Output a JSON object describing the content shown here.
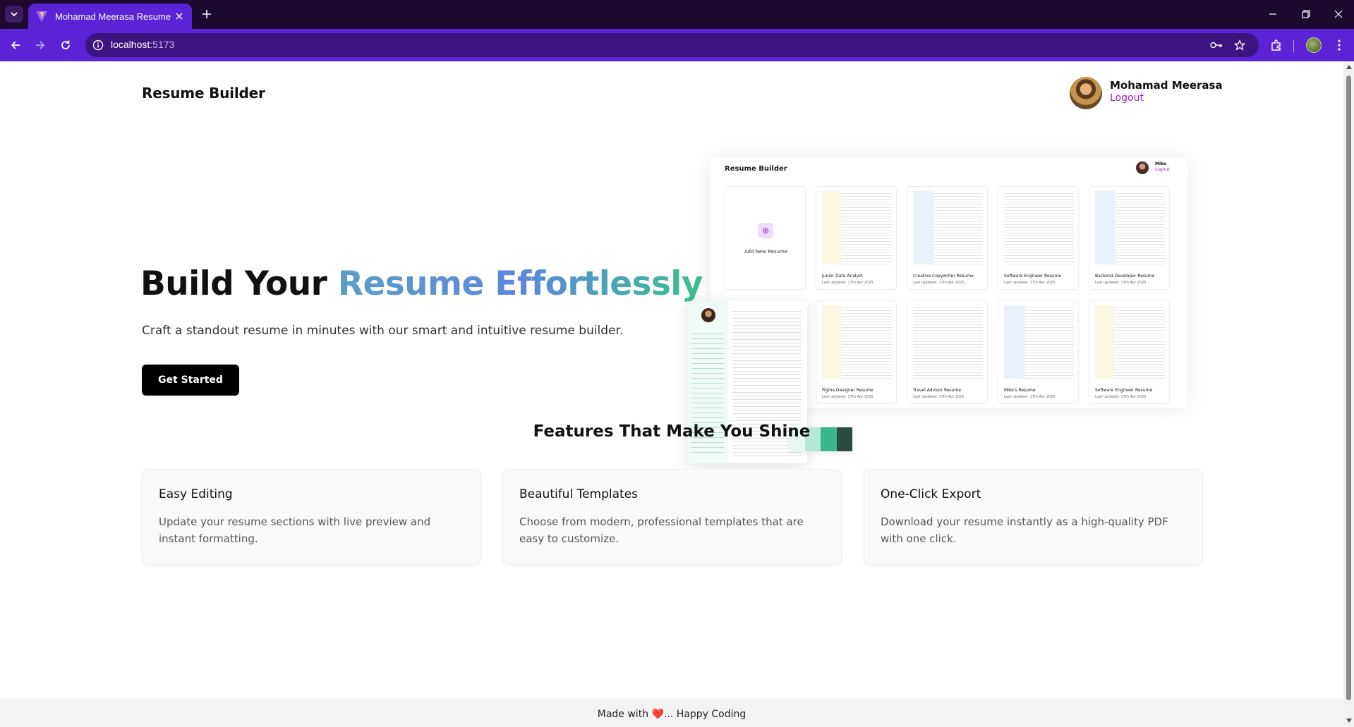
{
  "browser": {
    "tab_title": "Mohamad Meerasa Resume Bu",
    "url_host": "localhost",
    "url_port": ":5173"
  },
  "header": {
    "brand": "Resume Builder",
    "user_name": "Mohamad Meerasa",
    "logout_label": "Logout"
  },
  "hero": {
    "title_plain": "Build Your ",
    "title_gradient": "Resume Effortlessly",
    "subtitle": "Craft a standout resume in minutes with our smart and intuitive resume builder.",
    "cta_label": "Get Started"
  },
  "preview": {
    "brand": "Resume Builder",
    "user": "Mike",
    "logout": "Logout",
    "add_label": "Add New Resume",
    "cards": [
      {
        "name": "Junior Data Analyst",
        "meta": "Last Updated: 17th Apr 2025"
      },
      {
        "name": "Creative Copywriter Resume",
        "meta": "Last Updated: 17th Apr 2025"
      },
      {
        "name": "Software Engineer Resume",
        "meta": "Last Updated: 17th Apr 2025"
      },
      {
        "name": "Backend Developer Resume",
        "meta": "Last Updated: 17th Apr 2025"
      },
      {
        "name": "Figma Designer Resume",
        "meta": "Last Updated: 17th Apr 2025"
      },
      {
        "name": "Travel Advisor Resume",
        "meta": "Last Updated: 17th Apr 2025"
      },
      {
        "name": "Mike's Resume",
        "meta": "Last Updated: 17th Apr 2025"
      },
      {
        "name": "Software Engineer Resume",
        "meta": "Last Updated: 17th Apr 2025"
      }
    ],
    "swatch_colors": [
      "#e6f7f3",
      "#b6e7d6",
      "#3bb58a",
      "#2f4a44"
    ]
  },
  "features": {
    "title": "Features That Make You Shine",
    "items": [
      {
        "title": "Easy Editing",
        "desc": "Update your resume sections with live preview and instant formatting."
      },
      {
        "title": "Beautiful Templates",
        "desc": "Choose from modern, professional templates that are easy to customize."
      },
      {
        "title": "One-Click Export",
        "desc": "Download your resume instantly as a high-quality PDF with one click."
      }
    ]
  },
  "footer": {
    "before": "Made with ",
    "heart": "❤️",
    "after": "... Happy Coding"
  }
}
